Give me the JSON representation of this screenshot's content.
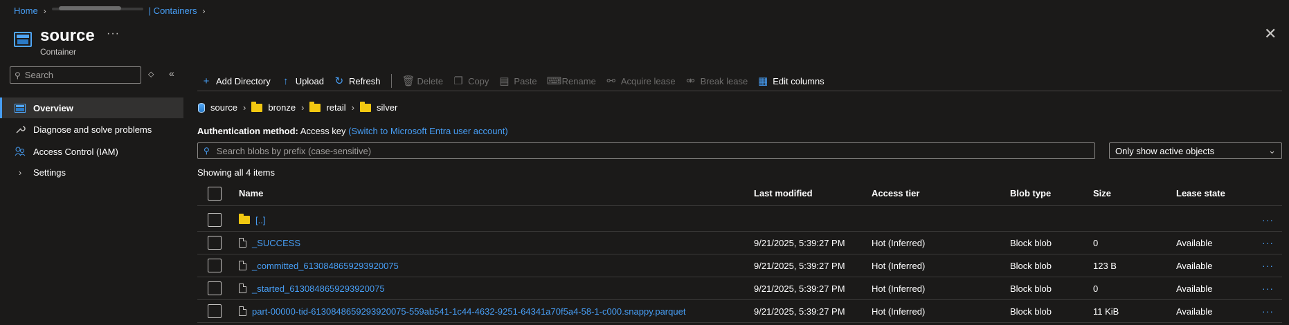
{
  "breadcrumb": {
    "home": "Home",
    "containers": "| Containers"
  },
  "header": {
    "title": "source",
    "subtitle": "Container",
    "more": "···",
    "close": "✕"
  },
  "nav": {
    "search_placeholder": "Search",
    "items": [
      {
        "label": "Overview",
        "icon": "overview-icon",
        "active": true
      },
      {
        "label": "Diagnose and solve problems",
        "icon": "wrench-icon"
      },
      {
        "label": "Access Control (IAM)",
        "icon": "people-icon"
      },
      {
        "label": "Settings",
        "icon": "chevron-right-icon"
      }
    ]
  },
  "toolbar": {
    "add_directory": "Add Directory",
    "upload": "Upload",
    "refresh": "Refresh",
    "delete": "Delete",
    "copy": "Copy",
    "paste": "Paste",
    "rename": "Rename",
    "acquire_lease": "Acquire lease",
    "break_lease": "Break lease",
    "edit_columns": "Edit columns"
  },
  "path": [
    "source",
    "bronze",
    "retail",
    "silver"
  ],
  "auth": {
    "label": "Authentication method:",
    "value": "Access key",
    "switch_link": "(Switch to Microsoft Entra user account)"
  },
  "blob_search_placeholder": "Search blobs by prefix (case-sensitive)",
  "filter_selected": "Only show active objects",
  "showing": "Showing all 4 items",
  "table": {
    "columns": [
      "Name",
      "Last modified",
      "Access tier",
      "Blob type",
      "Size",
      "Lease state"
    ],
    "rows": [
      {
        "name": "[..]",
        "kind": "folder",
        "modified": "",
        "tier": "",
        "type": "",
        "size": "",
        "lease": ""
      },
      {
        "name": "_SUCCESS",
        "kind": "file",
        "modified": "9/21/2025, 5:39:27 PM",
        "tier": "Hot (Inferred)",
        "type": "Block blob",
        "size": "0",
        "lease": "Available"
      },
      {
        "name": "_committed_6130848659293920075",
        "kind": "file",
        "modified": "9/21/2025, 5:39:27 PM",
        "tier": "Hot (Inferred)",
        "type": "Block blob",
        "size": "123 B",
        "lease": "Available"
      },
      {
        "name": "_started_6130848659293920075",
        "kind": "file",
        "modified": "9/21/2025, 5:39:27 PM",
        "tier": "Hot (Inferred)",
        "type": "Block blob",
        "size": "0",
        "lease": "Available"
      },
      {
        "name": "part-00000-tid-6130848659293920075-559ab541-1c44-4632-9251-64341a70f5a4-58-1-c000.snappy.parquet",
        "kind": "file",
        "modified": "9/21/2025, 5:39:27 PM",
        "tier": "Hot (Inferred)",
        "type": "Block blob",
        "size": "11 KiB",
        "lease": "Available"
      }
    ],
    "row_more": "···"
  },
  "colors": {
    "accent": "#479ef5",
    "background": "#1b1a19",
    "folder": "#f2c811"
  }
}
